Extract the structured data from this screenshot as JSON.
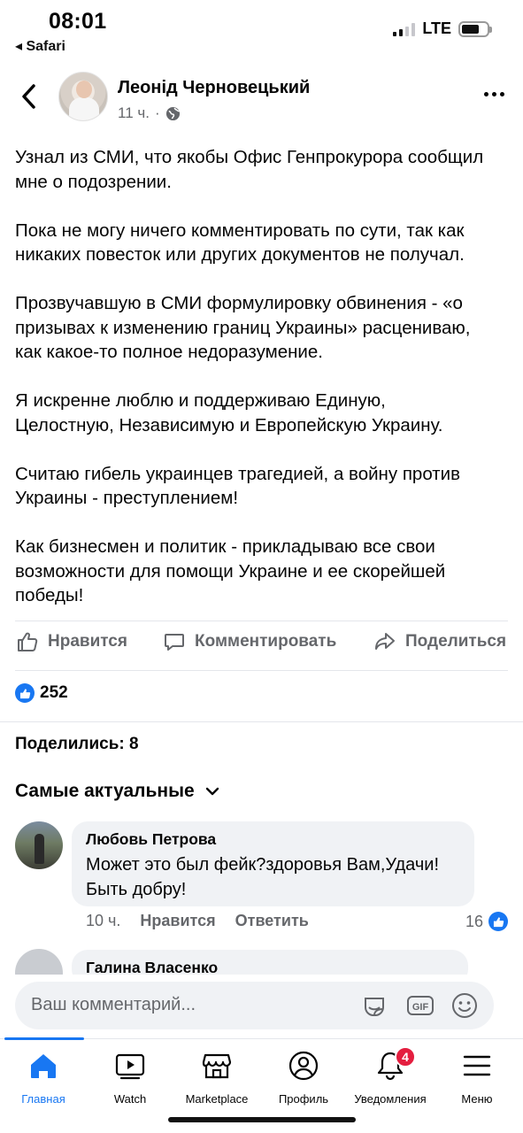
{
  "status_bar": {
    "time": "08:01",
    "back_app": "◂ Safari",
    "network": "LTE"
  },
  "post": {
    "author": "Леонід Черновецький",
    "time": "11 ч.",
    "separator": "·",
    "paragraphs": [
      "Узнал из СМИ, что якобы Офис Генпрокурора сообщил\nмне о подозрении.",
      "Пока не могу ничего комментировать по сути, так как\nникаких повесток или других документов не получал.",
      "Прозвучавшую в СМИ формулировку обвинения - «о\nпризывах к изменению границ Украины» расцениваю,\nкак какое-то  полное недоразумение.",
      "Я искренне люблю и поддерживаю Единую,\nЦелостную, Независимую и Европейскую Украину.",
      "Считаю гибель украинцев трагедией, а войну против\nУкраины - преступлением!",
      "Как бизнесмен и политик - прикладываю все свои\nвозможности для помощи Украине и ее скорейшей\nпобеды!"
    ]
  },
  "actions": {
    "like": "Нравится",
    "comment": "Комментировать",
    "share": "Поделиться"
  },
  "reactions": {
    "count": "252"
  },
  "shares": {
    "label": "Поделились: 8"
  },
  "comments_sort": {
    "label": "Самые актуальные"
  },
  "comments": [
    {
      "author": "Любовь Петрова",
      "text": "Может это был фейк?здоровья Вам,Удачи!\nБыть добру!",
      "time": "10 ч.",
      "like_label": "Нравится",
      "reply_label": "Ответить",
      "likes": "16"
    },
    {
      "author": "Галина Власенко"
    }
  ],
  "composer": {
    "placeholder": "Ваш комментарий..."
  },
  "tabs": [
    {
      "label": "Главная",
      "icon": "home-icon",
      "active": true
    },
    {
      "label": "Watch",
      "icon": "watch-icon"
    },
    {
      "label": "Marketplace",
      "icon": "marketplace-icon"
    },
    {
      "label": "Профиль",
      "icon": "profile-icon"
    },
    {
      "label": "Уведомления",
      "icon": "bell-icon",
      "badge": "4"
    },
    {
      "label": "Меню",
      "icon": "menu-icon"
    }
  ],
  "colors": {
    "accent": "#1877f2",
    "badge": "#e41e3f",
    "muted": "#65676b",
    "bubble": "#f0f2f5"
  }
}
